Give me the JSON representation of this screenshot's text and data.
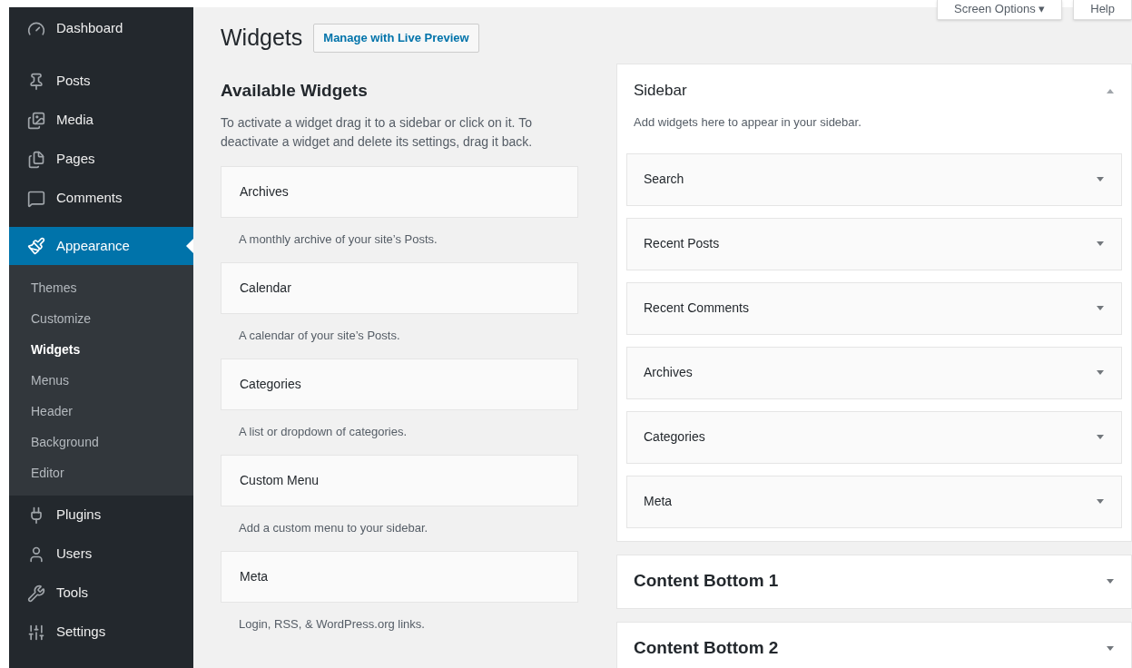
{
  "menu": [
    {
      "label": "Dashboard",
      "selected": false
    },
    {
      "label": "Posts",
      "selected": false
    },
    {
      "label": "Media",
      "selected": false
    },
    {
      "label": "Pages",
      "selected": false
    },
    {
      "label": "Comments",
      "selected": false
    },
    {
      "label": "Appearance",
      "selected": true,
      "children": [
        {
          "label": "Themes",
          "selected": false
        },
        {
          "label": "Customize",
          "selected": false
        },
        {
          "label": "Widgets",
          "selected": true
        },
        {
          "label": "Menus",
          "selected": false
        },
        {
          "label": "Header",
          "selected": false
        },
        {
          "label": "Background",
          "selected": false
        },
        {
          "label": "Editor",
          "selected": false
        }
      ]
    },
    {
      "label": "Plugins",
      "selected": false
    },
    {
      "label": "Users",
      "selected": false
    },
    {
      "label": "Tools",
      "selected": false
    },
    {
      "label": "Settings",
      "selected": false
    }
  ],
  "top_tabs": [
    {
      "label": "Screen Options ▾"
    },
    {
      "label": "Help"
    }
  ],
  "page_title": "Widgets",
  "live_preview_button": "Manage with Live Preview",
  "available": {
    "title": "Available Widgets",
    "description": "To activate a widget drag it to a sidebar or click on it. To deactivate a widget and delete its settings, drag it back.",
    "widgets": [
      {
        "name": "Archives",
        "description": "A monthly archive of your site’s Posts."
      },
      {
        "name": "Calendar",
        "description": "A calendar of your site’s Posts."
      },
      {
        "name": "Categories",
        "description": "A list or dropdown of categories."
      },
      {
        "name": "Custom Menu",
        "description": "Add a custom menu to your sidebar."
      },
      {
        "name": "Meta",
        "description": "Login, RSS, & WordPress.org links."
      }
    ]
  },
  "areas": [
    {
      "title": "Sidebar",
      "expanded": true,
      "description": "Add widgets here to appear in your sidebar.",
      "widgets": [
        "Search",
        "Recent Posts",
        "Recent Comments",
        "Archives",
        "Categories",
        "Meta"
      ]
    },
    {
      "title": "Content Bottom 1",
      "expanded": false
    },
    {
      "title": "Content Bottom 2",
      "expanded": false
    }
  ]
}
